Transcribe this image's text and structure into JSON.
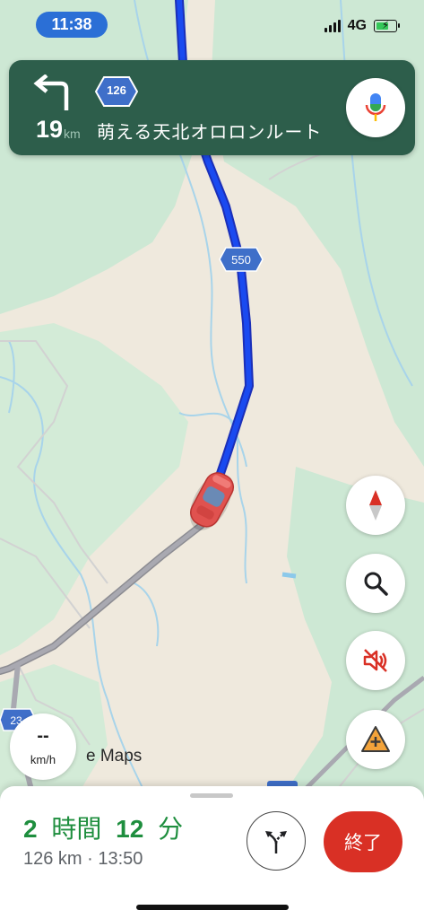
{
  "status_bar": {
    "time": "11:38",
    "network": "4G"
  },
  "navigation": {
    "distance_value": "19",
    "distance_unit": "km",
    "route_number": "126",
    "street_name": "萌える天北オロロンルート"
  },
  "map": {
    "road_label_550": "550",
    "road_label_23": "23",
    "watermark": "e Maps"
  },
  "speed": {
    "value": "--",
    "unit": "km/h"
  },
  "trip": {
    "hours": "2",
    "hours_unit": "時間",
    "minutes": "12",
    "minutes_unit": "分",
    "details": "126 km · 13:50",
    "end_label": "終了"
  },
  "colors": {
    "banner": "#2d5e4b",
    "route": "#1a3fe0",
    "eta_green": "#1e8e3e",
    "end_red": "#d93025"
  },
  "icons": [
    "turn-left-icon",
    "microphone-icon",
    "compass-icon",
    "search-icon",
    "mute-icon",
    "report-hazard-icon",
    "alternate-routes-icon",
    "car-icon"
  ]
}
